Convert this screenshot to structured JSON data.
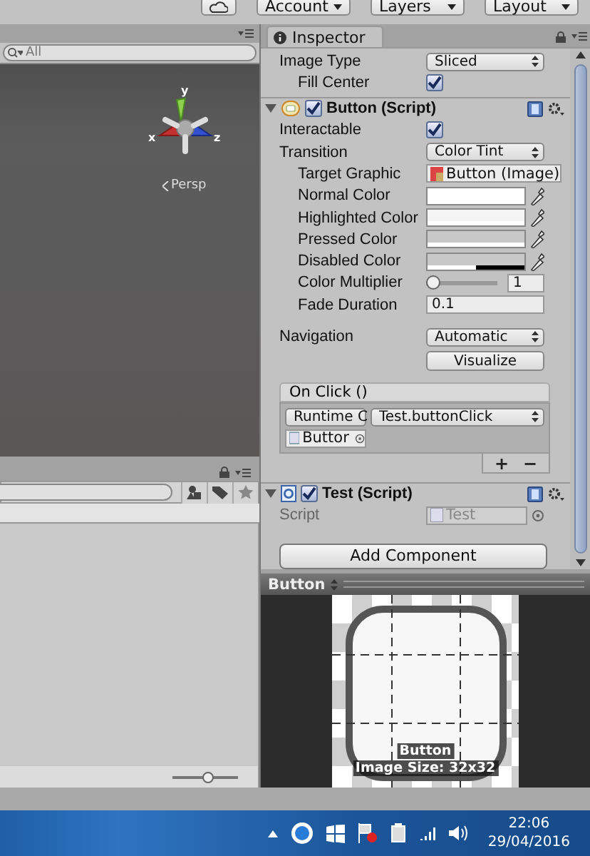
{
  "toolbar": {
    "dropdowns": [
      "Account",
      "Layers",
      "Layout"
    ]
  },
  "scene": {
    "search_placeholder": "All",
    "axes": [
      "y",
      "x",
      "z"
    ],
    "projection": "Persp"
  },
  "project": {
    "zoom": {
      "level": 0.55
    }
  },
  "inspector": {
    "tab": "Inspector",
    "properties": [
      {
        "kind": "dropdown",
        "label": "Image Type",
        "value": "Sliced",
        "children": [
          {
            "kind": "checkbox",
            "label": "Fill Center",
            "checked": true
          }
        ]
      }
    ],
    "components": [
      {
        "title": "Button (Script)",
        "kind": "button",
        "enabled": true,
        "expanded": true,
        "properties": [
          {
            "kind": "checkbox",
            "label": "Interactable",
            "checked": true
          },
          {
            "kind": "dropdown",
            "label": "Transition",
            "value": "Color Tint",
            "children": [
              {
                "kind": "object",
                "label": "Target Graphic",
                "value": "Button (Image)"
              },
              {
                "kind": "color",
                "label": "Normal Color",
                "color": "#ffffff",
                "level": 1
              },
              {
                "kind": "color",
                "label": "Highlighted Color",
                "color": "#f5f5f5",
                "level": 1
              },
              {
                "kind": "color",
                "label": "Pressed Color",
                "color": "#c8c8c8",
                "level": 1
              },
              {
                "kind": "color",
                "label": "Disabled Color",
                "color": "#c8c8c8",
                "level": 0.5
              },
              {
                "kind": "slider",
                "label": "Color Multiplier",
                "level": 0,
                "value": "1"
              },
              {
                "kind": "number",
                "label": "Fade Duration",
                "value": "0.1"
              }
            ]
          },
          {
            "kind": "dropdown",
            "label": "Navigation",
            "value": "Automatic"
          },
          {
            "kind": "button",
            "value": "Visualize"
          }
        ],
        "event": {
          "title": "On Click ()",
          "calls": [
            {
              "runtime": "Runtime C",
              "function": "Test.buttonClick",
              "target": "Buttor"
            }
          ],
          "buttons": [
            "+",
            "−"
          ]
        }
      },
      {
        "title": "Test (Script)",
        "kind": "script",
        "enabled": true,
        "expanded": true,
        "properties": [
          {
            "kind": "object",
            "label": "Script",
            "value": "Test",
            "disabled": true
          }
        ]
      }
    ],
    "add_button": "Add Component"
  },
  "preview": {
    "title": "Button",
    "caption": "Button",
    "size": "Image Size: 32x32"
  },
  "taskbar": {
    "time": "22:06",
    "date": "29/04/2016"
  }
}
